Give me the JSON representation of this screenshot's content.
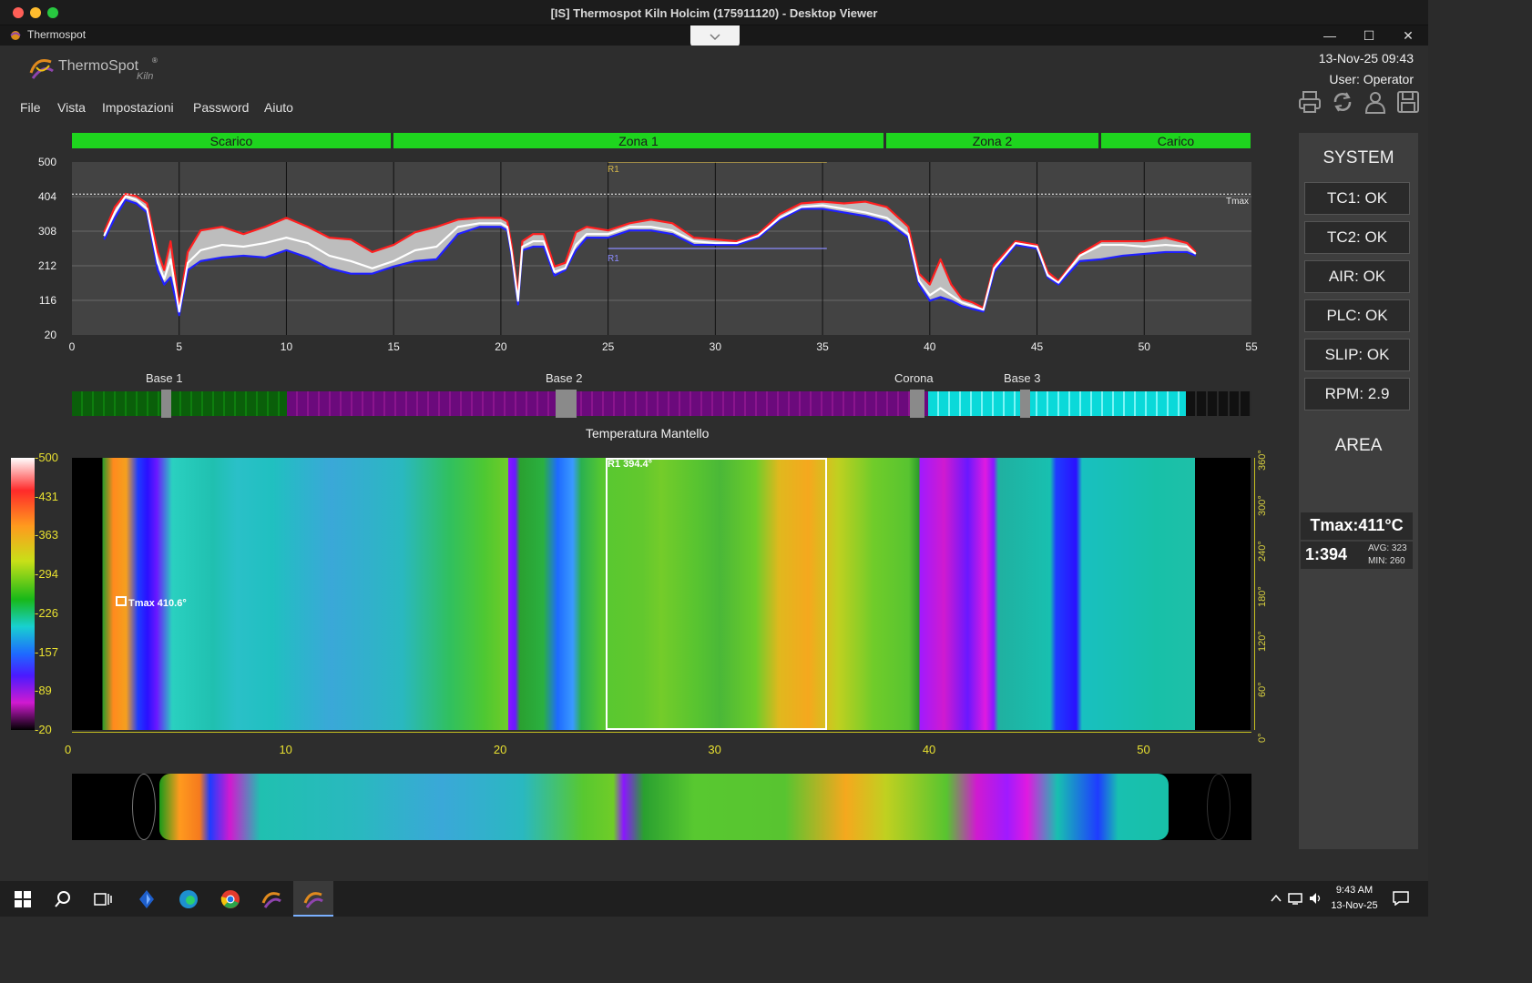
{
  "window": {
    "title": "[IS] Thermospot Kiln Holcim (175911120) - Desktop Viewer",
    "app_title": "Thermospot",
    "mac_dot_colors": [
      "#ff5f57",
      "#febc2e",
      "#28c840"
    ]
  },
  "header": {
    "logo_main": "ThermoSpot",
    "logo_reg": "®",
    "logo_sub": "Kiln",
    "datetime": "13-Nov-25 09:43",
    "user": "User: Operator",
    "toolbar_icons": [
      "printer-icon",
      "refresh-icon",
      "user-icon",
      "save-icon"
    ]
  },
  "menu": {
    "items": [
      "File",
      "Vista",
      "Impostazioni",
      "Password",
      "Aiuto"
    ]
  },
  "zones": [
    "Scarico",
    "Zona 1",
    "Zona 2",
    "Carico"
  ],
  "profile_chart": {
    "roi_label": "R1",
    "tmax_label": "Tmax"
  },
  "bases": {
    "labels": [
      "Base 1",
      "Base 2",
      "Corona",
      "Base 3"
    ],
    "caption": "Temperatura Mantello"
  },
  "thermal": {
    "roi_label": "R1 394.4°",
    "tmax_label": "Tmax 410.6°",
    "colorbar_ticks": [
      "500",
      "431",
      "363",
      "294",
      "226",
      "157",
      "89",
      "20"
    ],
    "angle_ticks": [
      "360°",
      "300°",
      "240°",
      "180°",
      "120°",
      "60°",
      "0°"
    ],
    "x_ticks": [
      "0",
      "10",
      "20",
      "30",
      "40",
      "50"
    ]
  },
  "side_panel": {
    "system_title": "SYSTEM",
    "status": [
      "TC1: OK",
      "TC2: OK",
      "AIR: OK",
      "PLC: OK",
      "SLIP: OK",
      "RPM: 2.9"
    ],
    "area_title": "AREA",
    "tmax": "Tmax:411°C",
    "roi_value": "1:394",
    "avg": "AVG: 323",
    "min": "MIN: 260"
  },
  "taskbar": {
    "time": "9:43 AM",
    "date": "13-Nov-25"
  },
  "chart_data": {
    "type": "line",
    "title": "",
    "xlabel": "",
    "ylabel": "",
    "xlim": [
      0,
      55
    ],
    "ylim": [
      20,
      500
    ],
    "x_ticks": [
      0,
      5,
      10,
      15,
      20,
      25,
      30,
      35,
      40,
      45,
      50,
      55
    ],
    "y_ticks": [
      20,
      116,
      212,
      308,
      404,
      500
    ],
    "tmax_line": 411,
    "roi": {
      "label": "R1",
      "x_start": 25,
      "x_end": 35.2,
      "max": 500,
      "min": 260
    },
    "grid": true,
    "x": [
      1.5,
      2,
      2.5,
      3,
      3.5,
      4,
      4.3,
      4.6,
      5,
      5.4,
      6,
      7,
      8,
      9,
      10,
      11,
      12,
      13,
      14,
      15,
      16,
      17,
      18,
      19,
      20,
      20.3,
      20.5,
      20.8,
      21,
      21.5,
      22,
      22.5,
      23,
      23.5,
      24,
      25,
      26,
      27,
      28,
      29,
      30,
      31,
      32,
      33,
      34,
      35,
      36,
      37,
      38,
      39,
      39.5,
      40,
      40.5,
      41,
      41.5,
      42,
      42.5,
      43,
      44,
      45,
      45.5,
      46,
      47,
      48,
      49,
      50,
      51,
      52,
      52.4
    ],
    "series": [
      {
        "color": "#ff2020",
        "values": [
          305,
          375,
          412,
          405,
          385,
          250,
          200,
          280,
          100,
          250,
          310,
          320,
          300,
          320,
          345,
          320,
          290,
          285,
          250,
          270,
          305,
          320,
          340,
          345,
          345,
          335,
          270,
          130,
          280,
          300,
          300,
          210,
          220,
          305,
          320,
          310,
          330,
          340,
          330,
          290,
          285,
          280,
          300,
          355,
          385,
          390,
          385,
          390,
          375,
          320,
          190,
          160,
          230,
          160,
          120,
          110,
          95,
          215,
          280,
          270,
          195,
          170,
          245,
          280,
          280,
          280,
          290,
          275,
          250
        ]
      },
      {
        "color": "#ffffff",
        "values": [
          295,
          360,
          405,
          395,
          370,
          220,
          175,
          230,
          85,
          220,
          255,
          270,
          265,
          275,
          290,
          275,
          240,
          225,
          205,
          225,
          255,
          265,
          320,
          330,
          330,
          320,
          250,
          115,
          265,
          280,
          280,
          195,
          205,
          270,
          300,
          300,
          320,
          320,
          310,
          280,
          275,
          275,
          295,
          345,
          375,
          380,
          370,
          360,
          345,
          300,
          170,
          130,
          150,
          130,
          110,
          100,
          90,
          205,
          275,
          265,
          185,
          165,
          240,
          270,
          270,
          265,
          270,
          265,
          245
        ]
      },
      {
        "color": "#2020ff",
        "values": [
          285,
          345,
          395,
          385,
          360,
          200,
          160,
          180,
          75,
          200,
          225,
          235,
          240,
          235,
          255,
          235,
          205,
          190,
          190,
          210,
          225,
          230,
          300,
          320,
          320,
          310,
          240,
          105,
          255,
          265,
          265,
          185,
          200,
          255,
          290,
          290,
          310,
          310,
          300,
          270,
          270,
          270,
          290,
          340,
          370,
          370,
          360,
          350,
          335,
          290,
          160,
          115,
          125,
          115,
          100,
          92,
          85,
          195,
          270,
          260,
          180,
          160,
          225,
          230,
          240,
          245,
          250,
          250,
          240
        ]
      }
    ]
  }
}
